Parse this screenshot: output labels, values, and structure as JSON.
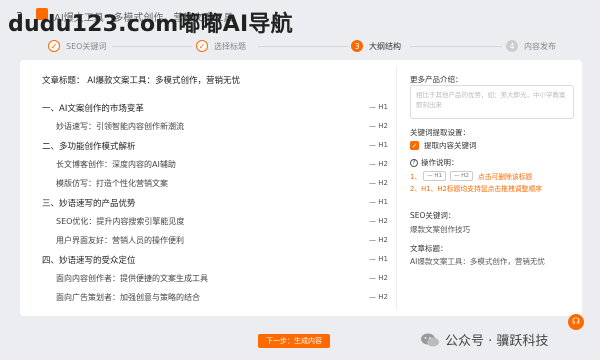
{
  "topbar": {
    "step_num": "3",
    "tab_title": "AI爆文工具 · 多模式创作，营销文案工具",
    "watermark": "dudu123.com嘟嘟AI导航"
  },
  "steps": [
    {
      "num": "✓",
      "label": "SEO关键词",
      "state": "done"
    },
    {
      "num": "✓",
      "label": "选择标题",
      "state": "done"
    },
    {
      "num": "3",
      "label": "大纲结构",
      "state": "active"
    },
    {
      "num": "4",
      "label": "内容发布",
      "state": "todo"
    }
  ],
  "article": {
    "title": "文章标题： AI爆款文案工具：多模式创作，营销无忧"
  },
  "outline": [
    {
      "text": "一、AI文案创作的市场变革",
      "level": "H1",
      "type": "h1"
    },
    {
      "text": "妙语速写：引领智能内容创作新潮流",
      "level": "H2",
      "type": "h2"
    },
    {
      "text": "二、多功能创作模式解析",
      "level": "H1",
      "type": "h1"
    },
    {
      "text": "长文博客创作：深度内容的AI辅助",
      "level": "H2",
      "type": "h2"
    },
    {
      "text": "模版仿写：打造个性化营销文案",
      "level": "H2",
      "type": "h2"
    },
    {
      "text": "三、妙语速写的产品优势",
      "level": "H1",
      "type": "h1"
    },
    {
      "text": "SEO优化：提升内容搜索引擎能见度",
      "level": "H2",
      "type": "h2"
    },
    {
      "text": "用户界面友好：营销人员的操作便利",
      "level": "H2",
      "type": "h2"
    },
    {
      "text": "四、妙语速写的受众定位",
      "level": "H1",
      "type": "h1"
    },
    {
      "text": "面向内容创作者：提供便捷的文案生成工具",
      "level": "H2",
      "type": "h2"
    },
    {
      "text": "面向广告策划者：加强创意与策略的结合",
      "level": "H2",
      "type": "h2"
    }
  ],
  "level_prefix": "—",
  "sidebar": {
    "intro_label": "更多产品介绍：",
    "intro_placeholder": "相比于其他产品的优势，如：美大即光，中小学教案即刻出来",
    "keyword_label": "关键词提取设置：",
    "keyword_checkbox": "提取内容关键词",
    "help_label": "操作说明：",
    "help_line1_prefix": "1、",
    "help_pill1": "— H1",
    "help_pill2": "— H2",
    "help_line1_suffix": "点击可删除该标题",
    "help_line2": "2、H1、H2标题均支持鼠点击拖拽调整顺序",
    "seo_label": "SEO关键词：",
    "seo_value": "爆款文案创作技巧",
    "title_label": "文章标题：",
    "title_value": "AI爆款文案工具：多模式创作，营销无忧"
  },
  "actions": {
    "next_label": "下一步：生成内容"
  },
  "footer": {
    "wechat_text": "公众号 · 骥跃科技"
  },
  "colors": {
    "accent": "#ff6a00"
  }
}
